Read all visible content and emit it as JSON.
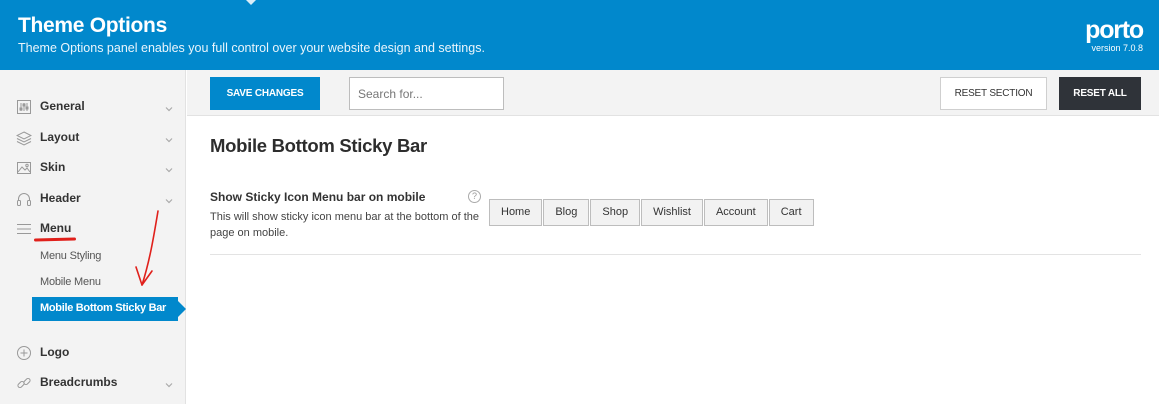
{
  "header": {
    "title": "Theme Options",
    "subtitle": "Theme Options panel enables you full control over your website design and settings.",
    "brand": "porto",
    "version": "version 7.0.8",
    "background": "#0188cc"
  },
  "sidebar": {
    "items": [
      {
        "label": "General",
        "icon": "sliders-icon",
        "has_chevron": true
      },
      {
        "label": "Layout",
        "icon": "layers-icon",
        "has_chevron": true
      },
      {
        "label": "Skin",
        "icon": "image-icon",
        "has_chevron": true
      },
      {
        "label": "Header",
        "icon": "headphones-icon",
        "has_chevron": true
      },
      {
        "label": "Menu",
        "icon": "hamburger-menu-icon",
        "has_chevron": false,
        "active": true
      },
      {
        "label": "Logo",
        "icon": "plus-circle-icon",
        "has_chevron": false
      },
      {
        "label": "Breadcrumbs",
        "icon": "link-icon",
        "has_chevron": true
      }
    ],
    "sub_items": [
      {
        "label": "Menu Styling"
      },
      {
        "label": "Mobile Menu"
      },
      {
        "label": "Mobile Bottom Sticky Bar",
        "active": true
      }
    ],
    "active_color": "#0188cc"
  },
  "toolbar": {
    "save_label": "SAVE CHANGES",
    "search_placeholder": "Search for...",
    "reset_section_label": "RESET SECTION",
    "reset_all_label": "RESET ALL"
  },
  "main": {
    "section_title": "Mobile Bottom Sticky Bar",
    "field": {
      "title": "Show Sticky Icon Menu bar on mobile",
      "description": "This will show sticky icon menu bar at the bottom of the page on mobile.",
      "help": "?",
      "options": [
        "Home",
        "Blog",
        "Shop",
        "Wishlist",
        "Account",
        "Cart"
      ]
    }
  },
  "annotations": {
    "color": "#e0201b"
  }
}
